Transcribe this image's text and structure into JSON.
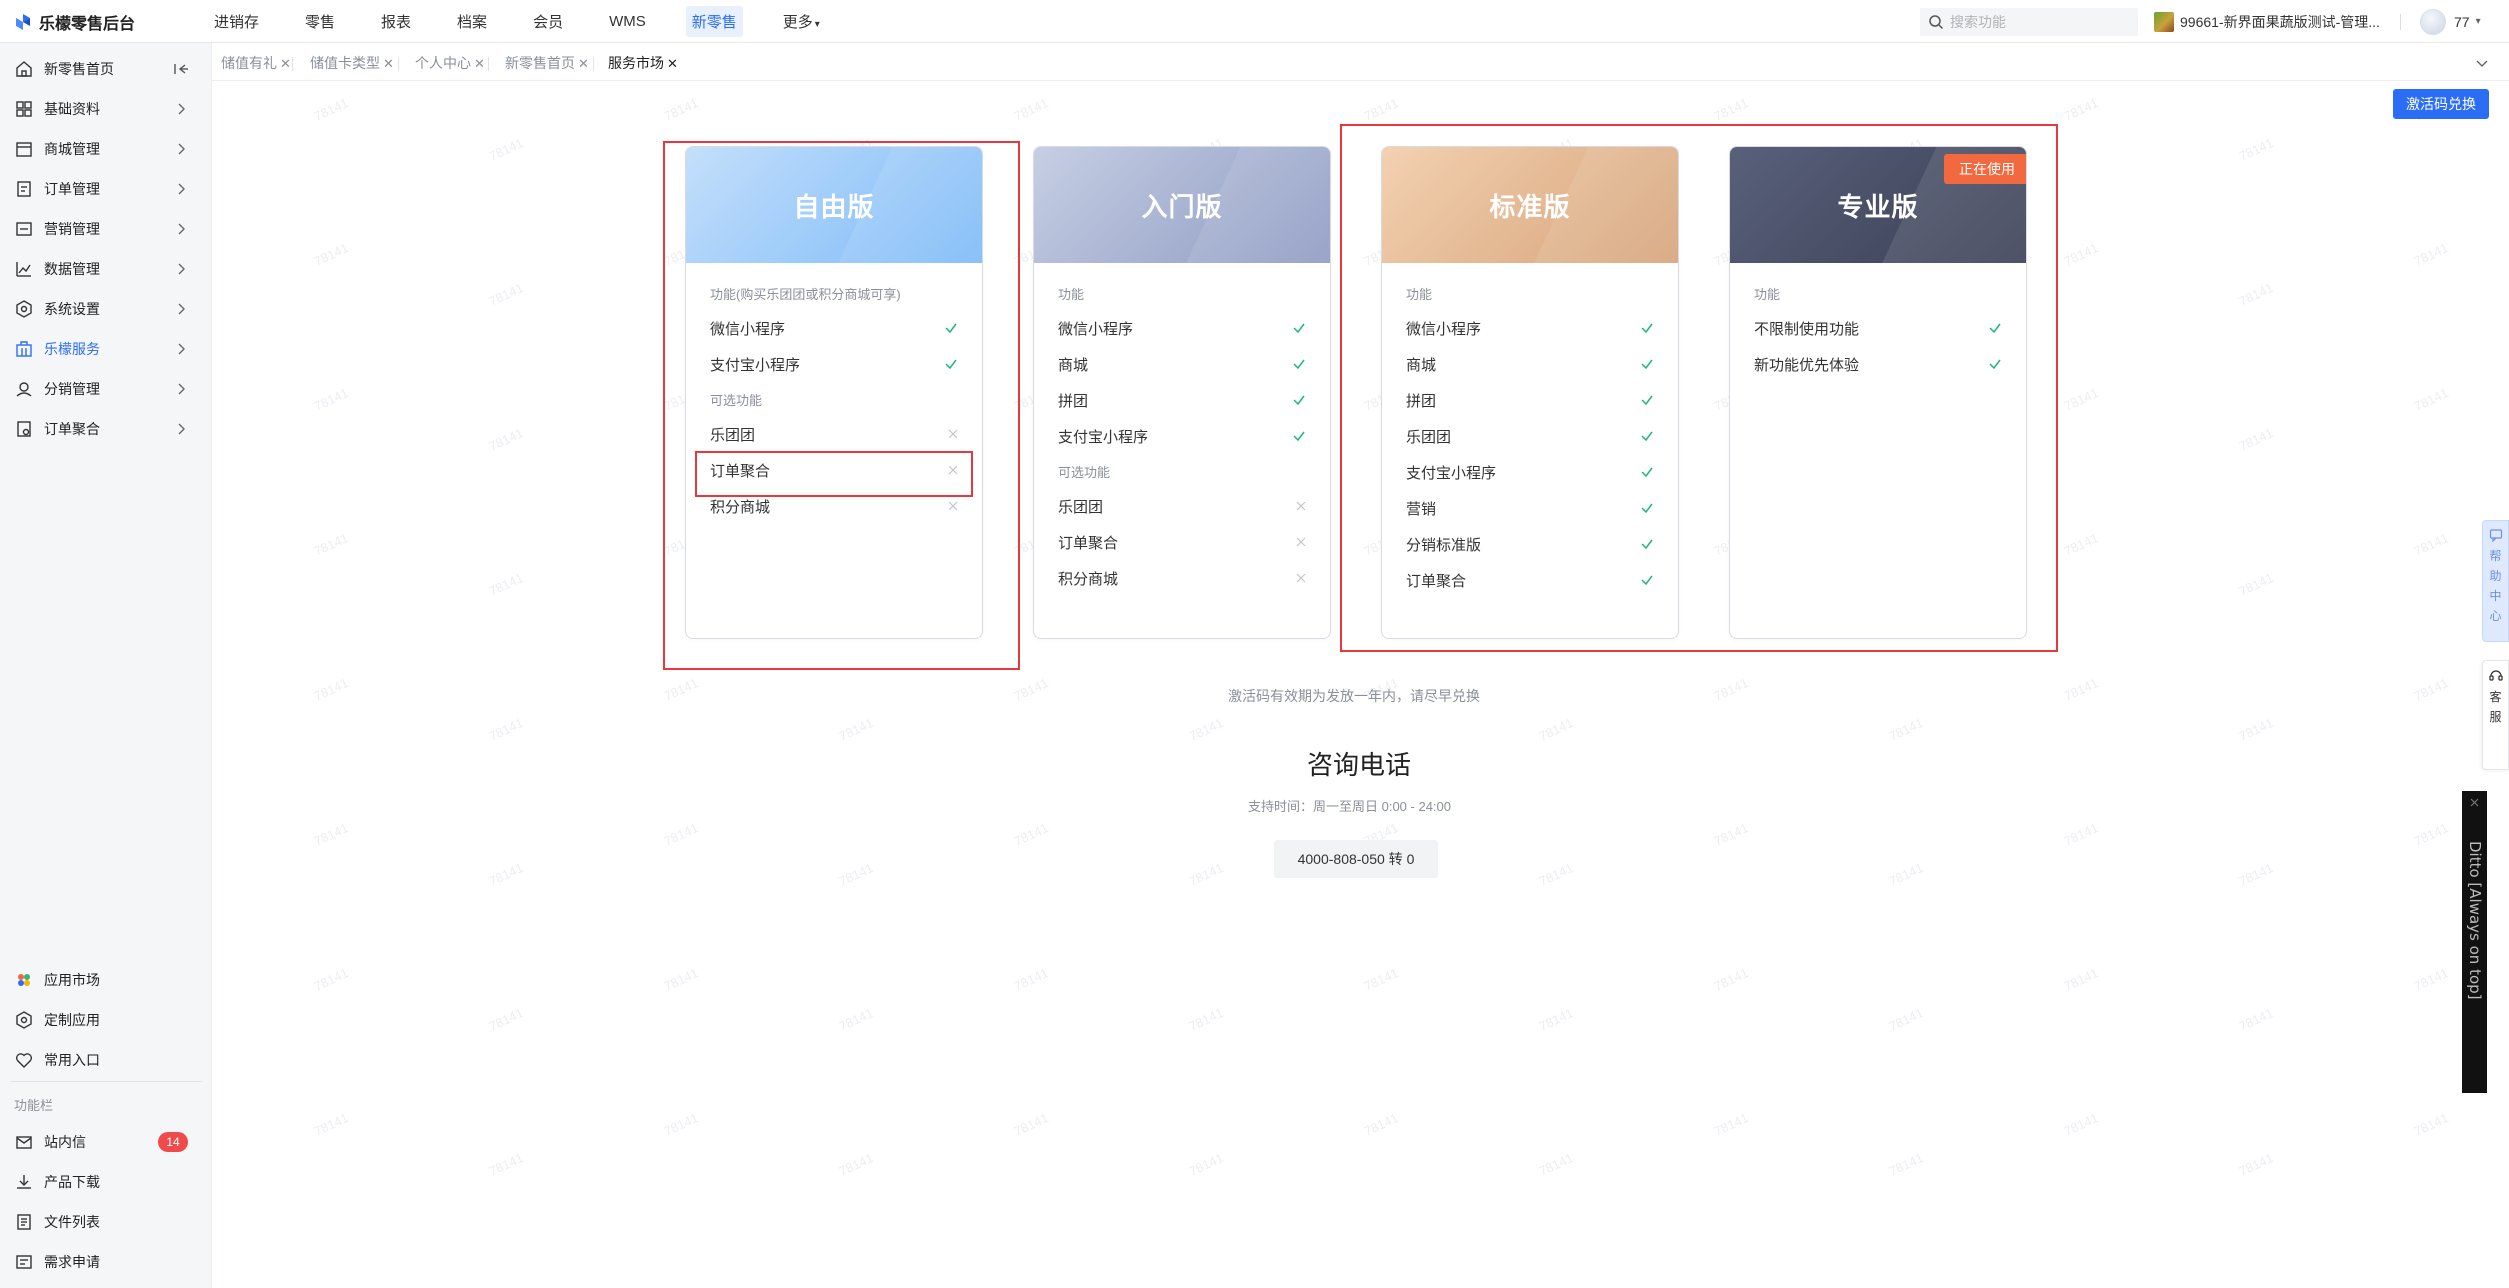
{
  "app": {
    "title": "乐檬零售后台",
    "brand_color": "#2b6ef5"
  },
  "topnav": {
    "items": [
      "进销存",
      "零售",
      "报表",
      "档案",
      "会员",
      "WMS",
      "新零售",
      "更多"
    ],
    "active": "新零售",
    "search_placeholder": "搜索功能",
    "store_name": "99661-新界面果蔬版测试-管理...",
    "user_name": "77"
  },
  "sidebar": {
    "items": [
      {
        "label": "新零售首页",
        "icon": "home-icon"
      },
      {
        "label": "基础资料",
        "icon": "grid-icon"
      },
      {
        "label": "商城管理",
        "icon": "shop-icon"
      },
      {
        "label": "订单管理",
        "icon": "order-icon"
      },
      {
        "label": "营销管理",
        "icon": "marketing-icon"
      },
      {
        "label": "数据管理",
        "icon": "chart-icon"
      },
      {
        "label": "系统设置",
        "icon": "settings-icon"
      },
      {
        "label": "乐檬服务",
        "icon": "service-icon",
        "active": true
      },
      {
        "label": "分销管理",
        "icon": "distribution-icon"
      },
      {
        "label": "订单聚合",
        "icon": "aggregate-icon"
      }
    ],
    "bottom_items": [
      {
        "label": "应用市场",
        "icon": "app-market-icon"
      },
      {
        "label": "定制应用",
        "icon": "custom-app-icon"
      },
      {
        "label": "常用入口",
        "icon": "heart-icon"
      }
    ],
    "section_label": "功能栏",
    "function_items": [
      {
        "label": "站内信",
        "icon": "mail-icon",
        "badge": "14"
      },
      {
        "label": "产品下载",
        "icon": "download-icon"
      },
      {
        "label": "文件列表",
        "icon": "file-list-icon"
      },
      {
        "label": "需求申请",
        "icon": "request-icon"
      }
    ]
  },
  "tabs": [
    {
      "label": "储值有礼",
      "active": false
    },
    {
      "label": "储值卡类型",
      "active": false
    },
    {
      "label": "个人中心",
      "active": false
    },
    {
      "label": "新零售首页",
      "active": false
    },
    {
      "label": "服务市场",
      "active": true
    }
  ],
  "main": {
    "activate_button": "激活码兑换",
    "note": "激活码有效期为发放一年内，请尽早兑换",
    "consult_title": "咨询电话",
    "support_time": "支持时间：周一至周日 0:00 - 24:00",
    "phone": "4000-808-050 转 0",
    "watermark": "78141",
    "plans": [
      {
        "title": "自由版",
        "colors": [
          "#c4dffb",
          "#7cbaf8"
        ],
        "section1": "功能(购买乐团团或积分商城可享)",
        "features": [
          {
            "label": "微信小程序",
            "included": true
          },
          {
            "label": "支付宝小程序",
            "included": true
          }
        ],
        "section2": "可选功能",
        "optional": [
          {
            "label": "乐团团",
            "included": false
          },
          {
            "label": "订单聚合",
            "included": false
          },
          {
            "label": "积分商城",
            "included": false
          }
        ]
      },
      {
        "title": "入门版",
        "colors": [
          "#c6cfe3",
          "#8d9ac3"
        ],
        "section1": "功能",
        "features": [
          {
            "label": "微信小程序",
            "included": true
          },
          {
            "label": "商城",
            "included": true
          },
          {
            "label": "拼团",
            "included": true
          },
          {
            "label": "支付宝小程序",
            "included": true
          }
        ],
        "section2": "可选功能",
        "optional": [
          {
            "label": "乐团团",
            "included": false
          },
          {
            "label": "订单聚合",
            "included": false
          },
          {
            "label": "积分商城",
            "included": false
          }
        ]
      },
      {
        "title": "标准版",
        "colors": [
          "#f3d1b1",
          "#d6a379"
        ],
        "section1": "功能",
        "features": [
          {
            "label": "微信小程序",
            "included": true
          },
          {
            "label": "商城",
            "included": true
          },
          {
            "label": "拼团",
            "included": true
          },
          {
            "label": "乐团团",
            "included": true
          },
          {
            "label": "支付宝小程序",
            "included": true
          },
          {
            "label": "营销",
            "included": true
          },
          {
            "label": "分销标准版",
            "included": true
          },
          {
            "label": "订单聚合",
            "included": true
          }
        ],
        "section2": "",
        "optional": []
      },
      {
        "title": "专业版",
        "colors": [
          "#59607a",
          "#3a3f55"
        ],
        "badge": "正在使用",
        "section1": "功能",
        "features": [
          {
            "label": "不限制使用功能",
            "included": true
          },
          {
            "label": "新功能优先体验",
            "included": true
          }
        ],
        "section2": "",
        "optional": []
      }
    ]
  },
  "floating": {
    "help_center": "帮助中心",
    "customer_service": "客服",
    "ditto": "Ditto [Always on top]"
  }
}
